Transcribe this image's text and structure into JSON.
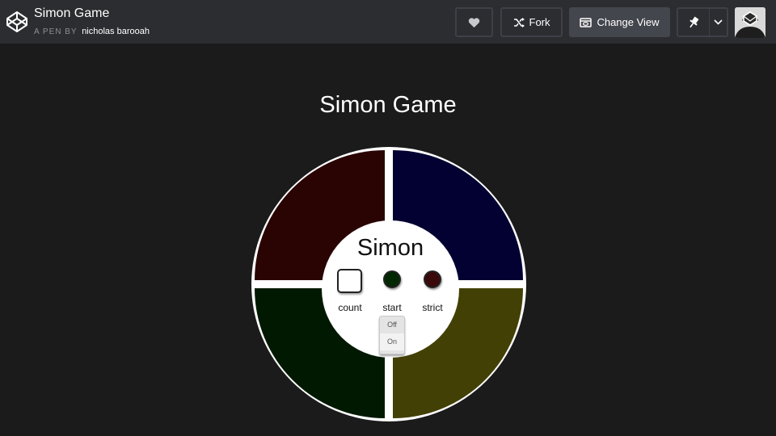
{
  "header": {
    "pen_title": "Simon Game",
    "pen_by_prefix": "A PEN BY",
    "author": "nicholas barooah",
    "fork_label": "Fork",
    "change_view_label": "Change View"
  },
  "icons": {
    "logo": "codepen-logo-icon",
    "heart": "heart-icon",
    "fork": "fork-icon",
    "view": "change-view-icon",
    "pin": "pin-icon",
    "chevron": "chevron-down-icon"
  },
  "game": {
    "title": "Simon Game",
    "board_label": "Simon",
    "count_label": "count",
    "start_label": "start",
    "strict_label": "strict",
    "switch_off": "Off",
    "switch_on": "On",
    "switch_state": "On"
  },
  "colors": {
    "quad_top_left": "#2a0303",
    "quad_top_right": "#020131",
    "quad_bottom_left": "#001900",
    "quad_bottom_right": "#424005",
    "start_button": "#012800",
    "strict_button": "#3a0a0a",
    "topbar": "#2c2d31",
    "background": "#1b1b1b"
  }
}
